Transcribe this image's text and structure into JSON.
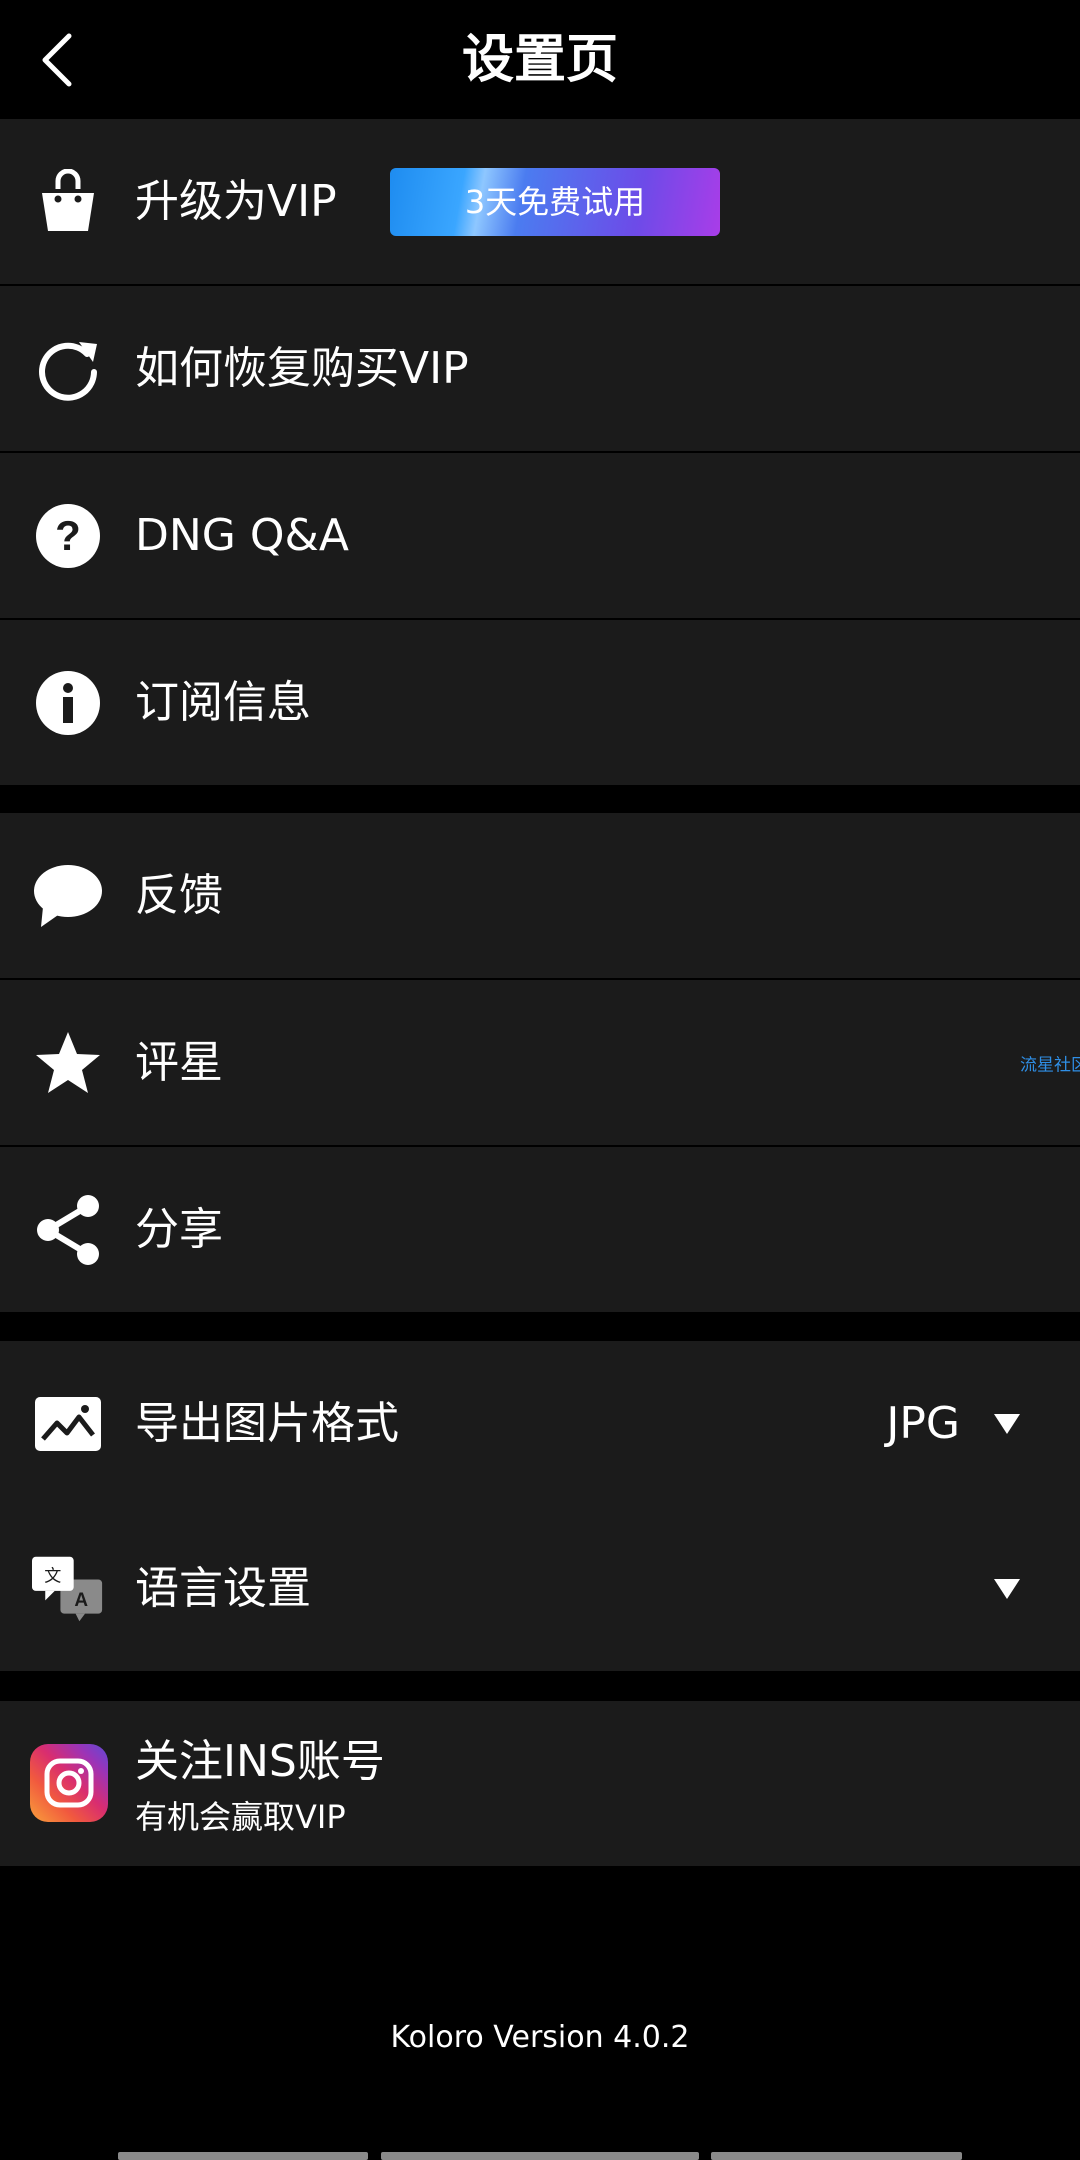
{
  "header": {
    "title": "设置页",
    "back_icon": "chevron-left-icon"
  },
  "group1": {
    "items": [
      {
        "label": "升级为VIP",
        "icon": "shopping-bag-icon",
        "badge": "3天免费试用"
      },
      {
        "label": "如何恢复购买VIP",
        "icon": "refresh-icon"
      },
      {
        "label": "DNG Q&A",
        "icon": "question-circle-icon"
      },
      {
        "label": "订阅信息",
        "icon": "info-circle-icon"
      }
    ]
  },
  "group2": {
    "items": [
      {
        "label": "反馈",
        "icon": "chat-bubble-icon"
      },
      {
        "label": "评星",
        "icon": "star-icon"
      },
      {
        "label": "分享",
        "icon": "share-icon"
      }
    ],
    "side_text": "流星社区"
  },
  "group3": {
    "export_format": {
      "label": "导出图片格式",
      "value": "JPG",
      "icon": "image-icon"
    },
    "language": {
      "label": "语言设置",
      "value": "",
      "icon": "translate-icon"
    }
  },
  "group4": {
    "instagram": {
      "title": "关注INS账号",
      "subtitle": "有机会赢取VIP",
      "icon": "instagram-icon"
    }
  },
  "footer": {
    "version": "Koloro Version 4.0.2"
  },
  "colors": {
    "background": "#000000",
    "row_background": "#1b1b1b",
    "text": "#ffffff",
    "badge_gradient_start": "#1e8cf0",
    "badge_gradient_end": "#a93de8"
  }
}
